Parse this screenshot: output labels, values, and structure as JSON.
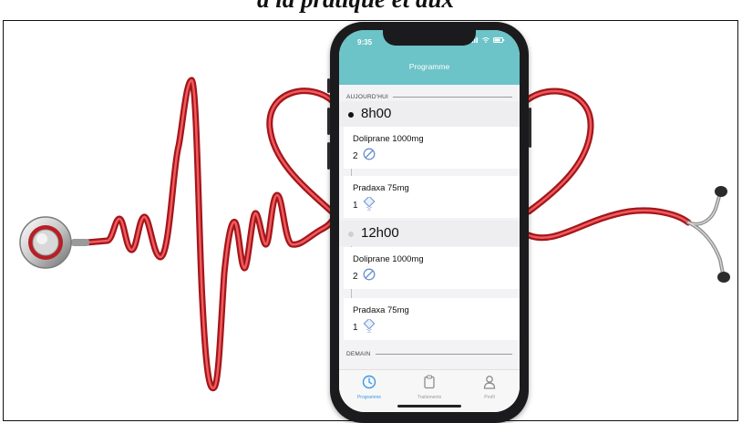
{
  "header": {
    "title": "Programme"
  },
  "status_bar": {
    "time": "9:35"
  },
  "colors": {
    "accent": "#6cc3c8",
    "tab_active": "#3b97e6",
    "heart_line": "#d9262a",
    "pill_icon": "#6a8fd0"
  },
  "sections": [
    {
      "label": "AUJOURD'HUI"
    },
    {
      "label": "DEMAIN"
    }
  ],
  "schedule": [
    {
      "time": "8h00",
      "items": [
        {
          "name": "Doliprane 1000mg",
          "qty": "2",
          "icon": "pill-tablet-icon"
        },
        {
          "name": "Pradaxa 75mg",
          "qty": "1",
          "icon": "capsule-icon"
        }
      ]
    },
    {
      "time": "12h00",
      "items": [
        {
          "name": "Doliprane 1000mg",
          "qty": "2",
          "icon": "pill-tablet-icon"
        },
        {
          "name": "Pradaxa 75mg",
          "qty": "1",
          "icon": "capsule-icon"
        }
      ]
    }
  ],
  "tabs": [
    {
      "label": "Programme",
      "icon": "clock-icon",
      "active": true
    },
    {
      "label": "Traitements",
      "icon": "clipboard-icon",
      "active": false
    },
    {
      "label": "Profil",
      "icon": "user-icon",
      "active": false
    }
  ]
}
